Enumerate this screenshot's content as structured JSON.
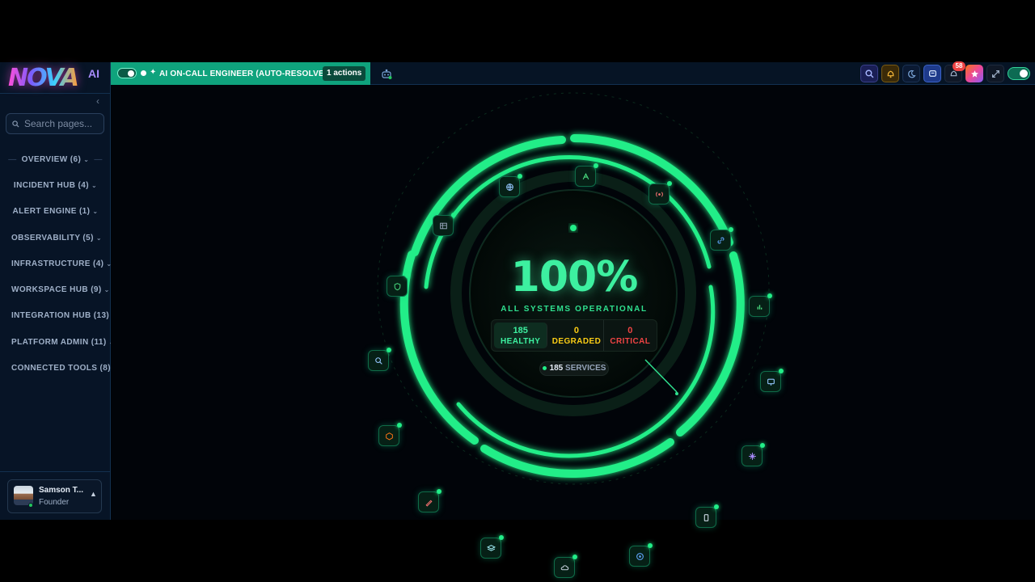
{
  "app": {
    "logo_text": "NOVA",
    "logo_suffix": "AI"
  },
  "sidebar": {
    "collapse_icon": "chevron-left-icon",
    "search_placeholder": "Search pages...",
    "items": [
      {
        "label": "OVERVIEW (6)"
      },
      {
        "label": "INCIDENT HUB (4)"
      },
      {
        "label": "ALERT ENGINE (1)"
      },
      {
        "label": "OBSERVABILITY (5)"
      },
      {
        "label": "INFRASTRUCTURE (4)"
      },
      {
        "label": "WORKSPACE HUB (9)"
      },
      {
        "label": "INTEGRATION HUB (13)"
      },
      {
        "label": "PLATFORM ADMIN (11)"
      },
      {
        "label": "CONNECTED TOOLS (8)"
      }
    ],
    "user": {
      "name": "Samson T...",
      "role": "Founder"
    }
  },
  "topbar": {
    "oncall_label": "AI ON-CALL ENGINEER (AUTO-RESOLVE)",
    "actions_badge": "1 actions",
    "notification_count": "58",
    "accent": "#0fa37d"
  },
  "gauge": {
    "percent_text": "100%",
    "percent_value": 100,
    "status": "ALL SYSTEMS OPERATIONAL",
    "healthy": {
      "value": "185",
      "label": "HEALTHY",
      "color": "#3df0a0"
    },
    "degraded": {
      "value": "0",
      "label": "DEGRADED",
      "color": "#facc15"
    },
    "critical": {
      "value": "0",
      "label": "CRITICAL",
      "color": "#ef4444"
    },
    "services_count": "185",
    "services_label": "SERVICES",
    "ring_color": "#22ee88"
  },
  "hub_icons": [
    "signal-icon",
    "radio-icon",
    "link-icon",
    "bar-chart-icon",
    "monitor-icon",
    "sparkle-icon",
    "phone-icon",
    "target-icon",
    "cloud-icon",
    "layers-icon",
    "pen-icon",
    "cube-icon",
    "search-icon",
    "shield-icon",
    "table-icon",
    "globe-icon"
  ]
}
